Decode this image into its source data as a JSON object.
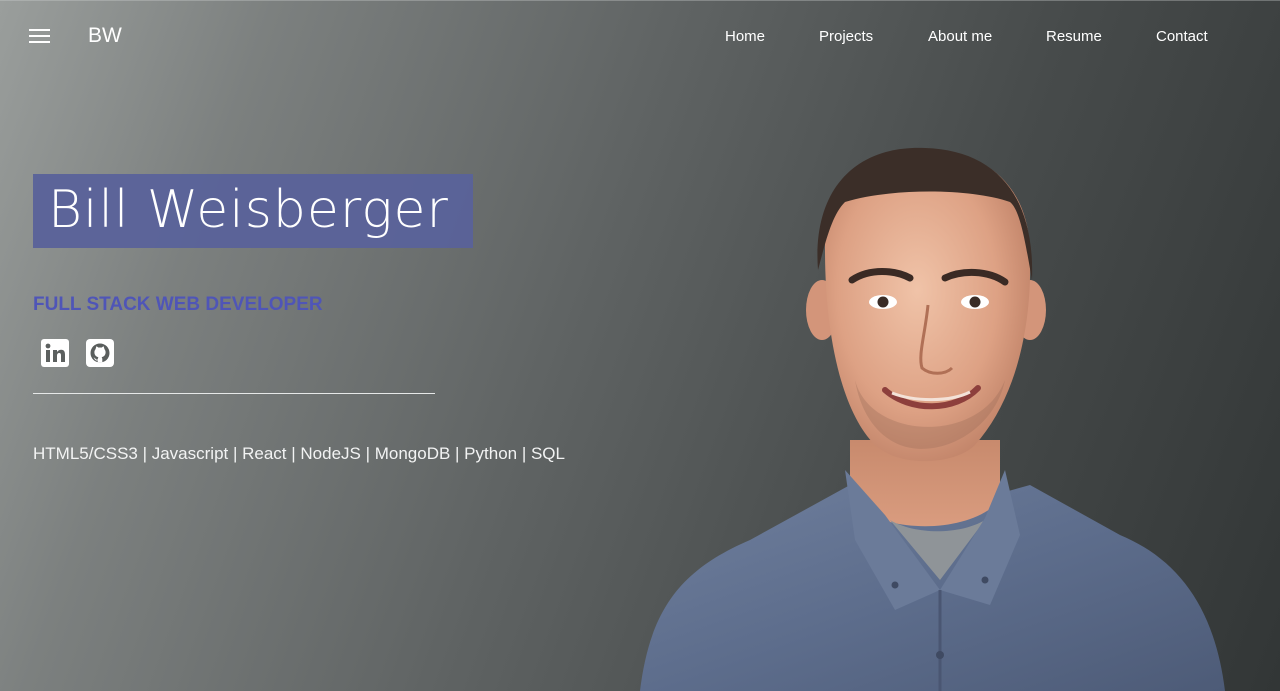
{
  "header": {
    "menu_icon": "hamburger-menu-icon",
    "brand": "BW",
    "nav": {
      "home": "Home",
      "projects": "Projects",
      "about": "About me",
      "resume": "Resume",
      "contact": "Contact"
    }
  },
  "hero": {
    "name": "Bill Weisberger",
    "subtitle": "FULL STACK WEB DEVELOPER",
    "skills": "HTML5/CSS3 | Javascript | React | NodeJS | MongoDB | Python | SQL",
    "social": [
      {
        "icon": "linkedin-icon"
      },
      {
        "icon": "github-icon"
      }
    ]
  },
  "colors": {
    "name_highlight": "#5a629a",
    "subtitle": "#4f55b7",
    "text": "#ffffff"
  }
}
